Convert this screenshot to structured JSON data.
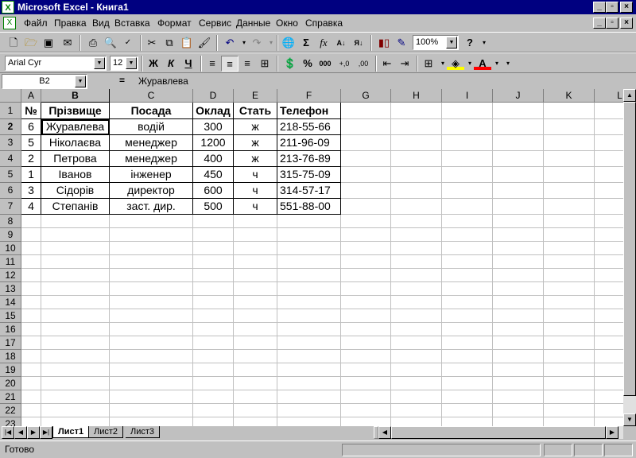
{
  "window": {
    "title": "Microsoft Excel - Книга1"
  },
  "menu": [
    "Файл",
    "Правка",
    "Вид",
    "Вставка",
    "Формат",
    "Сервис",
    "Данные",
    "Окно",
    "Справка"
  ],
  "menu_underline": [
    "Ф",
    "П",
    "В",
    "а",
    "о",
    "С",
    "Д",
    "О",
    "С"
  ],
  "toolbar": {
    "zoom": "100%",
    "font_name": "Arial Cyr",
    "font_size": "12"
  },
  "formula_bar": {
    "name_box": "B2",
    "equals": "=",
    "content": "Журавлева"
  },
  "columns": [
    "A",
    "B",
    "C",
    "D",
    "E",
    "F",
    "G",
    "H",
    "I",
    "J",
    "K",
    "L"
  ],
  "rows": [
    "1",
    "2",
    "3",
    "4",
    "5",
    "6",
    "7",
    "8",
    "9",
    "10",
    "11",
    "12",
    "13",
    "14",
    "15",
    "16",
    "17",
    "18",
    "19",
    "20",
    "21",
    "22",
    "23"
  ],
  "table": {
    "headers": [
      "№",
      "Прізвище",
      "Посада",
      "Оклад",
      "Стать",
      "Телефон"
    ],
    "data": [
      [
        "6",
        "Журавлева",
        "водій",
        "300",
        "ж",
        "218-55-66"
      ],
      [
        "5",
        "Ніколаєва",
        "менеджер",
        "1200",
        "ж",
        "211-96-09"
      ],
      [
        "2",
        "Петрова",
        "менеджер",
        "400",
        "ж",
        "213-76-89"
      ],
      [
        "1",
        "Іванов",
        "інженер",
        "450",
        "ч",
        "315-75-09"
      ],
      [
        "3",
        "Сідорів",
        "директор",
        "600",
        "ч",
        "314-57-17"
      ],
      [
        "4",
        "Степанів",
        "заст. дир.",
        "500",
        "ч",
        "551-88-00"
      ]
    ]
  },
  "sheets": [
    "Лист1",
    "Лист2",
    "Лист3"
  ],
  "active_sheet": "Лист1",
  "status": "Готово"
}
